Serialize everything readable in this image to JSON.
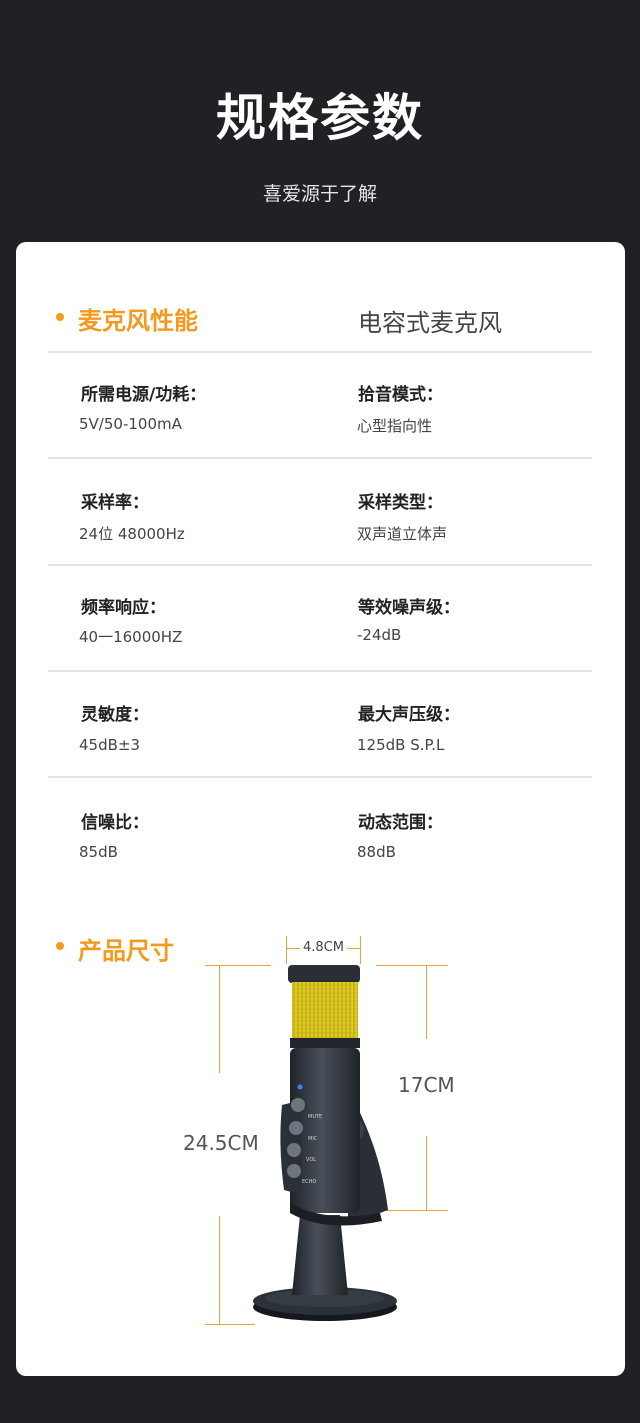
{
  "header": {
    "title": "规格参数",
    "subtitle": "喜爱源于了解"
  },
  "performance": {
    "title": "麦克风性能",
    "value": "电容式麦克风"
  },
  "specs": [
    {
      "label": "所需电源/功耗：",
      "value": "5V/50-100mA"
    },
    {
      "label": "拾音模式：",
      "value": "心型指向性"
    },
    {
      "label": "采样率：",
      "value": "24位 48000Hz"
    },
    {
      "label": "采样类型：",
      "value": "双声道立体声"
    },
    {
      "label": "频率响应：",
      "value": "40一16000HZ"
    },
    {
      "label": "等效噪声级：",
      "value": "-24dB"
    },
    {
      "label": "灵敏度：",
      "value": "45dB±3"
    },
    {
      "label": "最大声压级：",
      "value": "125dB S.P.L"
    },
    {
      "label": "信噪比：",
      "value": "85dB"
    },
    {
      "label": "动态范围：",
      "value": "88dB"
    }
  ],
  "dimensions": {
    "title": "产品尺寸",
    "width": "4.8CM",
    "head_height": "17CM",
    "total_height": "24.5CM"
  },
  "device_labels": {
    "mute": "MUTE",
    "mic": "MIC",
    "vol": "VOL",
    "echo": "ECHO"
  },
  "colors": {
    "background": "#212125",
    "accent": "#f39a1e",
    "mic_grille": "#e8d320",
    "mic_body": "#2f343c"
  }
}
